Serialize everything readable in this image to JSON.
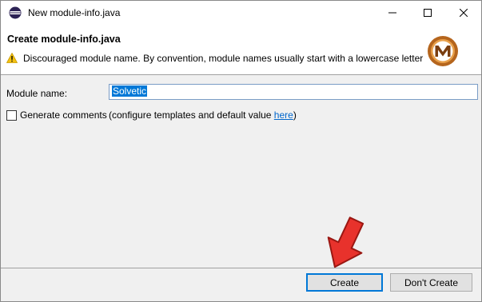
{
  "window": {
    "title": "New module-info.java"
  },
  "header": {
    "title": "Create module-info.java",
    "warning": "Discouraged module name. By convention, module names usually start with a lowercase letter"
  },
  "form": {
    "module_label": "Module name:",
    "module_value": "Solvetic",
    "generate_label": "Generate comments",
    "configure_text": "(configure templates and default value ",
    "configure_link": "here",
    "configure_close": ")",
    "generate_checked": false
  },
  "buttons": {
    "create": "Create",
    "dont_create": "Don't Create"
  },
  "colors": {
    "accent": "#0078d7",
    "arrow": "#e8322c",
    "logo": "#b5651d",
    "warning": "#f5c211"
  },
  "icons": {
    "app": "eclipse-icon",
    "warning": "warning-icon",
    "logo": "solvetic-logo",
    "annotation": "red-arrow"
  }
}
